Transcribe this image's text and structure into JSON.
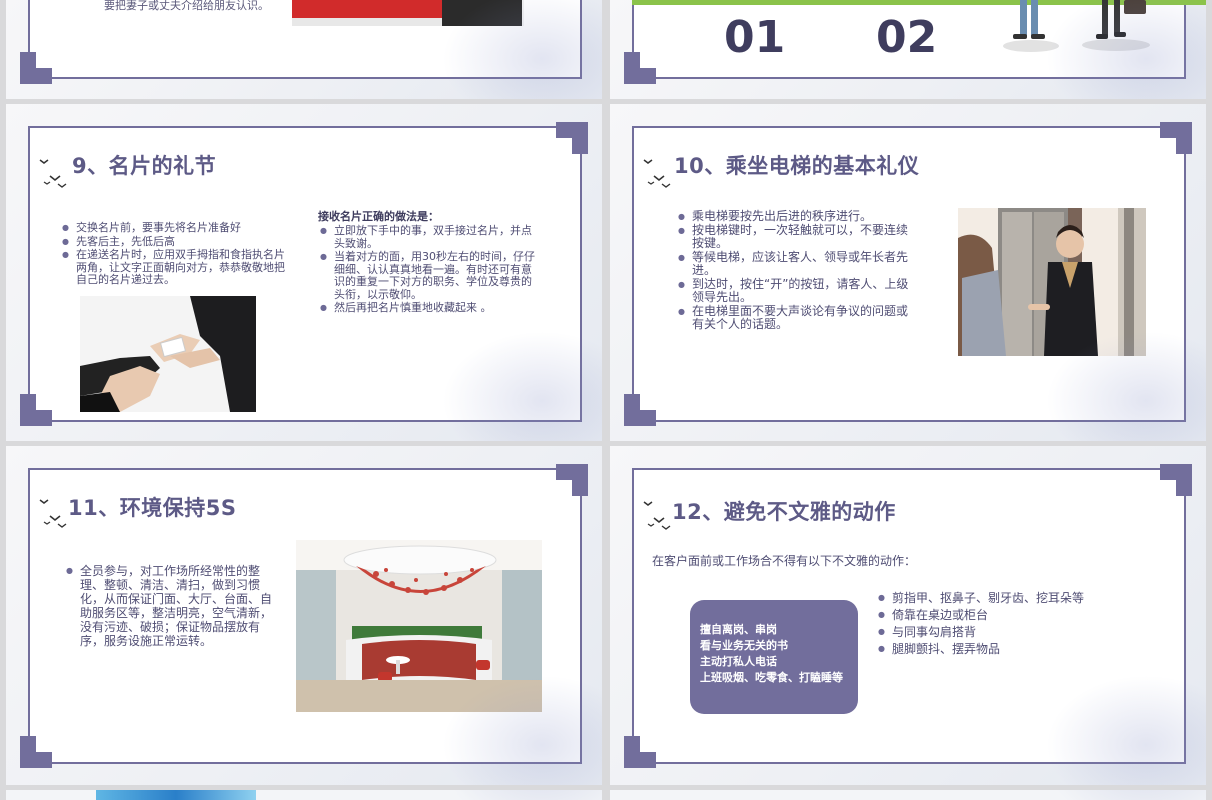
{
  "slide_top_left": {
    "partial_text": "要把妻子或丈夫介绍给朋友认识。"
  },
  "slide_top_right": {
    "numbers": [
      "01",
      "02"
    ]
  },
  "slide_business_card": {
    "title": "9、名片的礼节",
    "left_bullets": [
      "交换名片前，要事先将名片准备好",
      "先客后主，先低后高",
      "在递送名片时，应用双手拇指和食指执名片两角，让文字正面朝向对方，恭恭敬敬地把自己的名片递过去。"
    ],
    "right_heading": "接收名片正确的做法是：",
    "right_bullets": [
      "立即放下手中的事，双手接过名片，并点头致谢。",
      "当着对方的面，用30秒左右的时间，仔仔细细、认认真真地看一遍。有时还可有意识的重复一下对方的职务、学位及尊贵的头衔，以示敬仰。",
      "然后再把名片慎重地收藏起来 。"
    ]
  },
  "slide_elevator": {
    "title": "10、乘坐电梯的基本礼仪",
    "bullets": [
      "乘电梯要按先出后进的秩序进行。",
      "按电梯键时，一次轻触就可以，不要连续按键。",
      "等候电梯，应该让客人、领导或年长者先进。",
      "到达时，按住“开”的按钮，请客人、上级领导先出。",
      "在电梯里面不要大声谈论有争议的问题或有关个人的话题。"
    ]
  },
  "slide_5s": {
    "title": "11、环境保持5S",
    "bullets": [
      "全员参与，对工作场所经常性的整理、整顿、清洁、清扫，做到习惯化，从而保证门面、大厅、台面、自助服务区等，整洁明亮，空气清新，没有污迹、破损；保证物品摆放有序，服务设施正常运转。"
    ]
  },
  "slide_actions": {
    "title": "12、避免不文雅的动作",
    "intro": "在客户面前或工作场合不得有以下不文雅的动作：",
    "box_lines": [
      "擅自离岗、串岗",
      "看与业务无关的书",
      "主动打私人电话",
      "上班吸烟、吃零食、打瞌睡等"
    ],
    "bullets": [
      "剪指甲、抠鼻子、剔牙齿、挖耳朵等",
      "倚靠在桌边或柜台",
      "与同事勾肩搭背",
      "腿脚颤抖、摆弄物品"
    ]
  },
  "colors": {
    "accent": "#726e9c",
    "title": "#5d5a86",
    "text": "#4f4d73",
    "background": "#d9d9db",
    "green_bar": "#8bc34a"
  }
}
